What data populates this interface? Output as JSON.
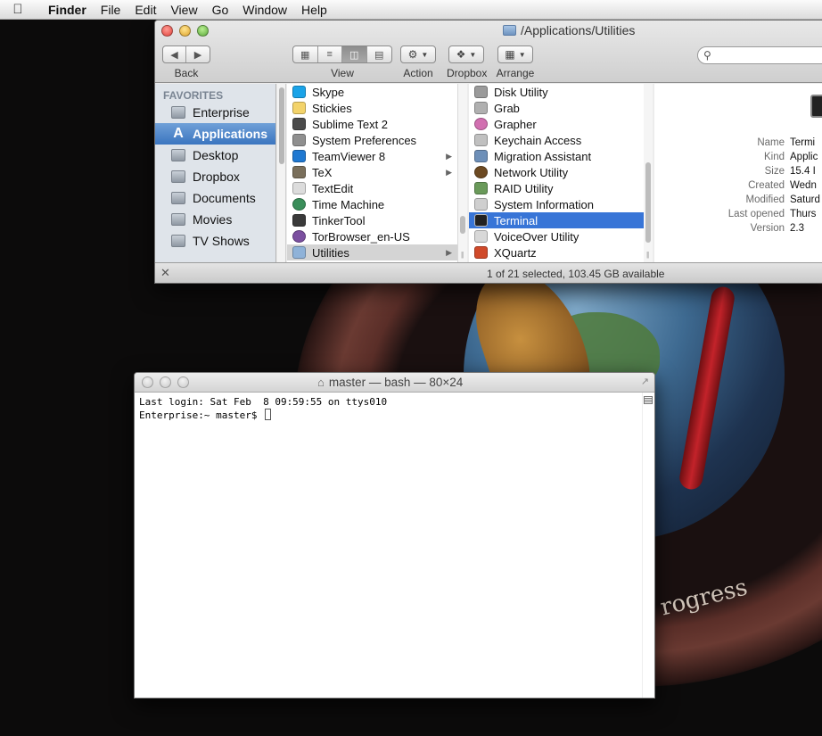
{
  "menubar": {
    "app_name": "Finder",
    "items": [
      "File",
      "Edit",
      "View",
      "Go",
      "Window",
      "Help"
    ]
  },
  "finder": {
    "title": "/Applications/Utilities",
    "toolbar": {
      "back_label": "Back",
      "view_label": "View",
      "action_label": "Action",
      "dropbox_label": "Dropbox",
      "arrange_label": "Arrange"
    },
    "sidebar": {
      "heading": "FAVORITES",
      "items": [
        {
          "label": "Enterprise",
          "icon": "computer-icon"
        },
        {
          "label": "Applications",
          "icon": "applications-icon",
          "selected": true
        },
        {
          "label": "Desktop",
          "icon": "desktop-icon"
        },
        {
          "label": "Dropbox",
          "icon": "dropbox-icon"
        },
        {
          "label": "Documents",
          "icon": "documents-icon"
        },
        {
          "label": "Movies",
          "icon": "folder-icon"
        },
        {
          "label": "TV Shows",
          "icon": "folder-icon"
        }
      ]
    },
    "applications_column": [
      {
        "label": "Skype",
        "color": "#1aa3e8"
      },
      {
        "label": "Stickies",
        "color": "#f3d36a"
      },
      {
        "label": "Sublime Text 2",
        "color": "#4b4b4b"
      },
      {
        "label": "System Preferences",
        "color": "#8f8f8f"
      },
      {
        "label": "TeamViewer 8",
        "color": "#1f78d1",
        "has_children": true
      },
      {
        "label": "TeX",
        "color": "#7a6f5b",
        "has_children": true
      },
      {
        "label": "TextEdit",
        "color": "#dcdcdc"
      },
      {
        "label": "Time Machine",
        "color": "#3a8e5a"
      },
      {
        "label": "TinkerTool",
        "color": "#3a3a3a"
      },
      {
        "label": "TorBrowser_en-US",
        "color": "#7b4fa0"
      },
      {
        "label": "Utilities",
        "color": "#8fb2d8",
        "has_children": true,
        "selected": true
      }
    ],
    "utilities_column": [
      {
        "label": "Disk Utility",
        "color": "#9a9a9a"
      },
      {
        "label": "Grab",
        "color": "#b0b0b0"
      },
      {
        "label": "Grapher",
        "color": "#d16fb0"
      },
      {
        "label": "Keychain Access",
        "color": "#c0c0c0"
      },
      {
        "label": "Migration Assistant",
        "color": "#6d8fb8"
      },
      {
        "label": "Network Utility",
        "color": "#6d4a22"
      },
      {
        "label": "RAID Utility",
        "color": "#6a9a5a"
      },
      {
        "label": "System Information",
        "color": "#cfcfcf"
      },
      {
        "label": "Terminal",
        "color": "#222222",
        "selected": true
      },
      {
        "label": "VoiceOver Utility",
        "color": "#d8d8d8"
      },
      {
        "label": "XQuartz",
        "color": "#d04a2a"
      }
    ],
    "preview": {
      "fields": [
        {
          "key": "Name",
          "value": "Termi"
        },
        {
          "key": "Kind",
          "value": "Applic"
        },
        {
          "key": "Size",
          "value": "15.4 I"
        },
        {
          "key": "Created",
          "value": "Wedn"
        },
        {
          "key": "Modified",
          "value": "Saturd"
        },
        {
          "key": "Last opened",
          "value": "Thurs"
        },
        {
          "key": "Version",
          "value": "2.3"
        }
      ]
    },
    "status": "1 of 21 selected, 103.45 GB available"
  },
  "terminal": {
    "title": "master — bash — 80×24",
    "lines": [
      "Last login: Sat Feb  8 09:59:55 on ttys010",
      "Enterprise:~ master$ "
    ]
  },
  "wallpaper": {
    "text": "rogress"
  }
}
